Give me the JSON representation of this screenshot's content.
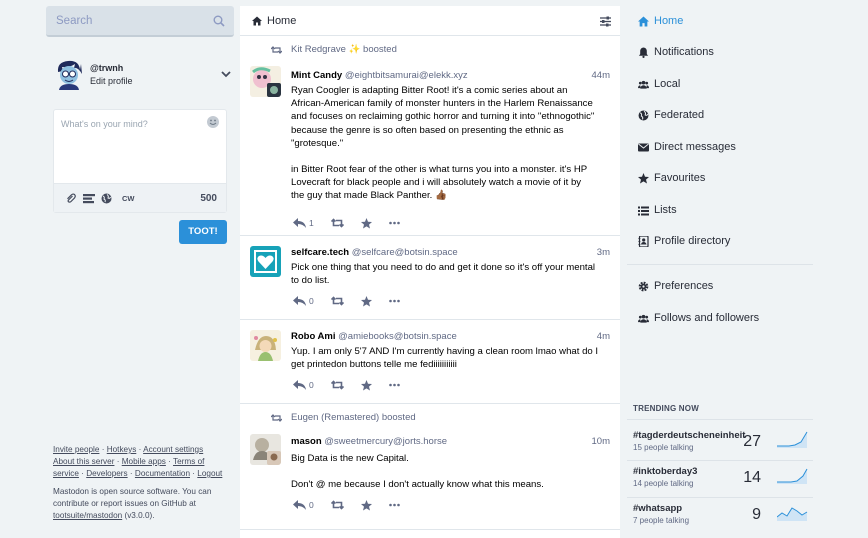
{
  "search": {
    "placeholder": "Search"
  },
  "profile": {
    "handle": "@trwnh",
    "edit_label": "Edit profile"
  },
  "compose": {
    "placeholder": "What's on your mind?",
    "cw_label": "CW",
    "char_count": "500",
    "toot_label": "TOOT!"
  },
  "footer": {
    "links_line1": [
      "Invite people",
      "Hotkeys",
      "Account settings"
    ],
    "links_line2": [
      "About this server",
      "Mobile apps",
      "Terms of"
    ],
    "links_line3_a": "service",
    "links_line3": [
      "Developers",
      "Documentation",
      "Logout"
    ],
    "about_line1": "Mastodon is open source software. You can",
    "about_line2": "contribute or report issues on GitHub at",
    "about_link": "tootsuite/mastodon",
    "about_version": " (v3.0.0)."
  },
  "column": {
    "title": "Home"
  },
  "statuses": [
    {
      "booster": "Kit Redgrave",
      "boost_emoji": "✨",
      "boost_suffix": " boosted",
      "display_name": "Mint Candy",
      "acct": "@eightbitsamurai@elekk.xyz",
      "time": "44m",
      "para1_lines": [
        "Ryan Coogler is adapting Bitter Root! it's a comic series about an",
        "African-American family of monster hunters in the Harlem Renaissance",
        "and focuses on reclaiming gothic horror and turning it into \"ethnogothic\"",
        "because the genre is so often based on presenting the ethnic as",
        "\"grotesque.\""
      ],
      "para2_lines": [
        "in Bitter Root fear of the other is what turns you into a monster. it's HP",
        "Lovecraft for black people and i will absolutely watch a movie of it by",
        "the guy that made Black Panther. 👍🏾"
      ],
      "replies": "1"
    },
    {
      "display_name": "selfcare.tech",
      "acct": "@selfcare@botsin.space",
      "time": "3m",
      "lines": [
        "Pick one thing that you need to do and get it done so it's off your mental",
        "to do list."
      ],
      "replies": "0"
    },
    {
      "display_name": "Robo Ami",
      "acct": "@amiebooks@botsin.space",
      "time": "4m",
      "lines": [
        "Yup. I am only 5'7 AND I'm currently having a clean room lmao what do I",
        "get printedon buttons telle me fediiiiiiiiiii"
      ],
      "replies": "0"
    },
    {
      "booster": "Eugen (Remastered)",
      "boost_suffix": " boosted",
      "display_name": "mason",
      "acct": "@sweetmercury@jorts.horse",
      "time": "10m",
      "para1": "Big Data is the new Capital.",
      "para2": "Don't @ me because I don't actually know what this means.",
      "replies": "0"
    }
  ],
  "nav": {
    "items": [
      {
        "label": "Home",
        "icon": "home-icon",
        "active": true
      },
      {
        "label": "Notifications",
        "icon": "bell-icon"
      },
      {
        "label": "Local",
        "icon": "users-icon"
      },
      {
        "label": "Federated",
        "icon": "globe-icon"
      },
      {
        "label": "Direct messages",
        "icon": "envelope-icon"
      },
      {
        "label": "Favourites",
        "icon": "star-icon"
      },
      {
        "label": "Lists",
        "icon": "list-icon"
      },
      {
        "label": "Profile directory",
        "icon": "address-book-icon"
      },
      {
        "label": "Preferences",
        "icon": "gear-icon"
      },
      {
        "label": "Follows and followers",
        "icon": "users-icon"
      }
    ]
  },
  "trending": {
    "title": "TRENDING NOW",
    "items": [
      {
        "tag": "#tagderdeutscheneinheit",
        "people": "15 people talking",
        "uses": "27"
      },
      {
        "tag": "#inktoberday3",
        "people": "14 people talking",
        "uses": "14"
      },
      {
        "tag": "#whatsapp",
        "people": "7 people talking",
        "uses": "9"
      }
    ]
  },
  "colors": {
    "accent": "#2b90d9",
    "background": "#eff3f5",
    "text": "#282c37",
    "muted": "#606984"
  }
}
